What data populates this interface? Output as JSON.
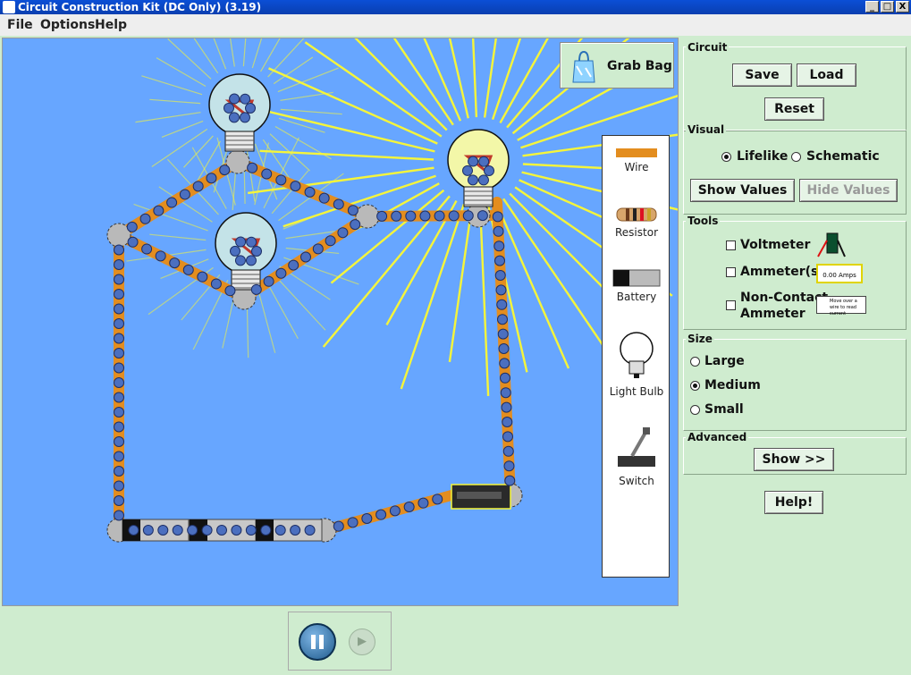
{
  "window": {
    "title": "Circuit Construction Kit (DC Only) (3.19)",
    "minimize": "_",
    "maximize": "□",
    "close": "X"
  },
  "menu": [
    "File",
    "Options",
    "Help"
  ],
  "grab_bag": {
    "label": "Grab Bag"
  },
  "toolbox": {
    "items": [
      "Wire",
      "Resistor",
      "Battery",
      "Light Bulb",
      "Switch"
    ]
  },
  "circuit": {
    "title": "Circuit",
    "save": "Save",
    "load": "Load",
    "reset": "Reset"
  },
  "visual": {
    "title": "Visual",
    "lifelike": "Lifelike",
    "schematic": "Schematic",
    "selected": "Lifelike",
    "show_values": "Show Values",
    "hide_values": "Hide Values"
  },
  "tools": {
    "title": "Tools",
    "voltmeter": "Voltmeter",
    "ammeter": "Ammeter(s)",
    "noncontact_1": "Non-Contact",
    "noncontact_2": "Ammeter",
    "ammeter_readout": "0.00 Amps",
    "noncontact_hint": "Move over a wire to read current"
  },
  "size": {
    "title": "Size",
    "large": "Large",
    "medium": "Medium",
    "small": "Small",
    "selected": "Medium"
  },
  "advanced": {
    "title": "Advanced",
    "show": "Show >>"
  },
  "help": {
    "label": "Help!"
  },
  "colors": {
    "background": "#67a6ff",
    "wire": "#e38d1f",
    "panel": "#cfeccf",
    "light_rays": "#f5f53a",
    "electron": "#4b6fbf"
  }
}
